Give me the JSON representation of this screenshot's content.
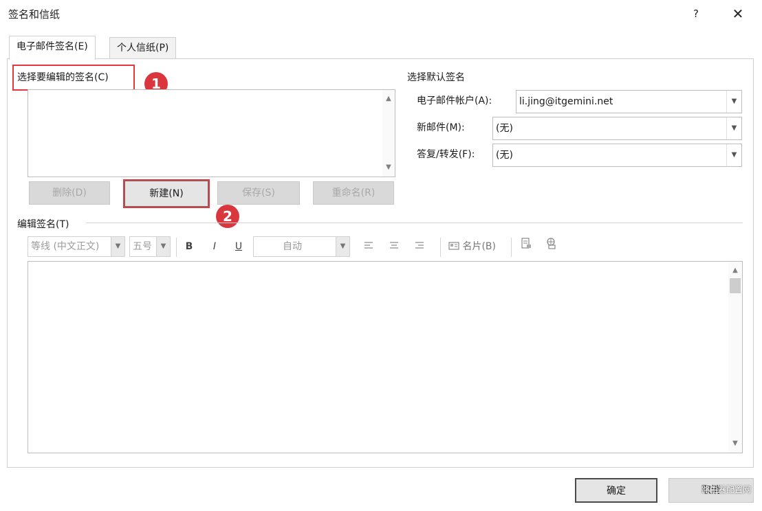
{
  "window": {
    "title": "签名和信纸",
    "help": "?",
    "close": "✕"
  },
  "tabs": [
    {
      "label": "电子邮件签名(E)",
      "active": true
    },
    {
      "label": "个人信纸(P)",
      "active": false
    }
  ],
  "signatures": {
    "label": "选择要编辑的签名(C)",
    "items": [],
    "buttons": {
      "delete": "删除(D)",
      "new": "新建(N)",
      "save": "保存(S)",
      "rename": "重命名(R)"
    }
  },
  "defaults": {
    "heading": "选择默认签名",
    "account_label": "电子邮件帐户(A):",
    "account_value": "li.jing@itgemini.net",
    "new_label": "新邮件(M):",
    "new_value": "(无)",
    "reply_label": "答复/转发(F):",
    "reply_value": "(无)"
  },
  "editor": {
    "heading": "编辑签名(T)",
    "font": "等线 (中文正文)",
    "size": "五号",
    "bold": "B",
    "italic": "I",
    "underline": "U",
    "color": "自动",
    "business_card": "名片(B)"
  },
  "markers": {
    "one": "1",
    "two": "2"
  },
  "footer": {
    "ok": "确定",
    "cancel": "取消"
  },
  "watermark": "路由器配置网",
  "colors": {
    "marker": "#d9363e",
    "marker_box": "#e0383f"
  },
  "icons": [
    "help-icon",
    "close-icon",
    "align-left-icon",
    "align-center-icon",
    "align-right-icon",
    "business-card-icon",
    "insert-picture-icon",
    "hyperlink-icon"
  ]
}
